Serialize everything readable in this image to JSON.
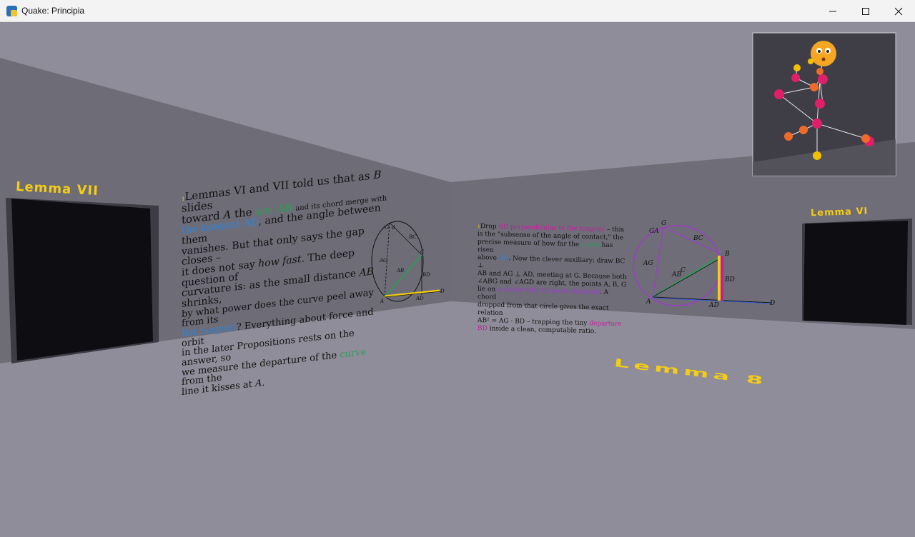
{
  "window": {
    "title": "Quake: Principia",
    "minimize_icon": "minimize-icon",
    "maximize_icon": "maximize-icon",
    "close_icon": "close-icon"
  },
  "doors": {
    "left_label": "Lemma VII",
    "right_label": "Lemma VI"
  },
  "floor_text": "Lemma 8",
  "left_wall": {
    "marker": "1",
    "p1": "Lemmas VI and VII told us that as",
    "p1_var": "B",
    "p1_b": "slides",
    "p2": "toward",
    "p2_var": "A",
    "p2_b": "the",
    "arc": "arc AB",
    "p2_c": "and its chord merge with",
    "tangent": "the tangent AD",
    "p3": ", and the angle between them",
    "p4": "vanishes. But that only says the gap closes –",
    "p5a": "it does not say",
    "p5_em": "how fast",
    "p5b": ". The deep question of",
    "p6": "curvature is: as the small distance",
    "p6_var": "AB",
    "p6_b": "shrinks,",
    "p7": "by what power does the curve peel away from its",
    "flat": "flat tangent",
    "p8": "? Everything about force and orbit",
    "p9": "in the later Propositions rests on the answer, so",
    "p10a": "we measure the departure of the",
    "p10_curve": "curve",
    "p10b": "from the",
    "p11": "line it kisses at",
    "p11_var": "A",
    "p11_end": "."
  },
  "left_diagram": {
    "labels": [
      "G",
      "d",
      "BC",
      "AG",
      "C",
      "BD",
      "AB",
      "A",
      "AD",
      "D"
    ]
  },
  "right_wall": {
    "marker": "1",
    "lines": [
      [
        "Drop ",
        "BD perpendicular to the tangent",
        " – this"
      ],
      [
        "is the \"subsense of the angle of contact,\" the"
      ],
      [
        "precise measure of how far the ",
        "curve",
        " has risen"
      ],
      [
        "above ",
        "AD",
        ". Now the clever auxiliary: draw BC ⊥"
      ],
      [
        "AB and AG ⊥ AD, meeting at G. Because both"
      ],
      [
        "∠ABG and ∠AGD are right, the points A, B, G"
      ],
      [
        "lie on ",
        "a circle with AG as its diameter",
        ". A chord"
      ],
      [
        "dropped from that circle gives the exact relation"
      ],
      [
        "AB² = AG · BD – trapping the tiny ",
        "departure"
      ],
      [
        "BD",
        " inside a clean, computable ratio."
      ]
    ]
  },
  "right_diagram": {
    "labels": [
      "G",
      "GA",
      "BC",
      "AG",
      "B",
      "C",
      "AB",
      "BD",
      "A",
      "AD",
      "D"
    ]
  },
  "colors": {
    "sky": "#8f8d99",
    "far_wall": "#6f6d78",
    "floor": "#8f8d99",
    "door": "#0e0e12",
    "gold": "#f3cc16",
    "green": "#2e9b57",
    "blue": "#2f84d6",
    "magenta": "#c0209c",
    "purple": "#9b3fc7"
  },
  "minimap": {
    "face_icon": "flushed-face-icon"
  }
}
